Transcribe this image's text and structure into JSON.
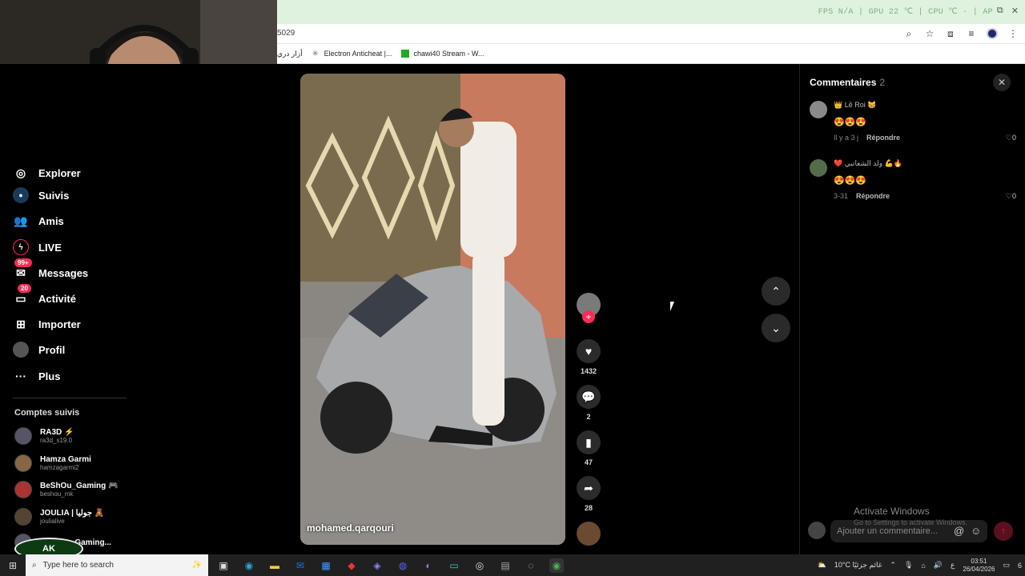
{
  "browser": {
    "hud_text": "FPS N/A  |  GPU 22 ℃  |  CPU ℃  ·  |  AP",
    "url_fragment": "5029",
    "bookmarks": [
      {
        "label": "أزار دري",
        "icon": "folder-icon"
      },
      {
        "label": "Electron Anticheat |...",
        "icon": "electron-icon"
      },
      {
        "label": "chawi40 Stream - W...",
        "icon": "kick-icon"
      }
    ]
  },
  "sidebar": {
    "nav": [
      {
        "label": "Explorer",
        "icon": "compass-icon"
      },
      {
        "label": "Suivis",
        "icon": "following-icon"
      },
      {
        "label": "Amis",
        "icon": "friends-icon"
      },
      {
        "label": "LIVE",
        "icon": "live-icon"
      },
      {
        "label": "Messages",
        "icon": "message-icon",
        "badge": "99+"
      },
      {
        "label": "Activité",
        "icon": "activity-icon",
        "badge": "20"
      },
      {
        "label": "Importer",
        "icon": "upload-icon"
      },
      {
        "label": "Profil",
        "icon": "profile-icon"
      },
      {
        "label": "Plus",
        "icon": "more-icon"
      }
    ],
    "following_title": "Comptes suivis",
    "following": [
      {
        "name": "RA3D ⚡",
        "handle": "ra3d_s19.0"
      },
      {
        "name": "Hamza Garmi",
        "handle": "hamzagarmi2"
      },
      {
        "name": "BeShOu_Gaming 🎮",
        "handle": "beshou_mk"
      },
      {
        "name": "JOULIA | جوليا 🧸",
        "handle": "joulialive"
      },
      {
        "name": "Fahouza Gaming...",
        "handle": ""
      }
    ],
    "logo_text": "AK"
  },
  "video": {
    "creator": "mohamed.qarqouri"
  },
  "actions": {
    "likes": "1432",
    "comments": "2",
    "saves": "47",
    "shares": "28"
  },
  "comments_panel": {
    "title": "Commentaires",
    "count": "2",
    "items": [
      {
        "user": "👑 Lē Roi 😸",
        "text": "😍😍😍",
        "time": "Il y a 3 j",
        "reply": "Répondre",
        "likes": "0"
      },
      {
        "user": "❤️ ولد الشعاتبي 💪🔥",
        "text": "😍😍😍",
        "time": "3-31",
        "reply": "Répondre",
        "likes": "0"
      }
    ],
    "input_placeholder": "Ajouter un commentaire..."
  },
  "watermark": {
    "line1": "Activate Windows",
    "line2": "Go to Settings to activate Windows."
  },
  "taskbar": {
    "search_placeholder": "Type here to search",
    "weather": "10°C  غائم جزئيًا",
    "time": "03:51",
    "date": "26/04/2026",
    "lang": "ع",
    "notif": "6"
  },
  "colors": {
    "accent": "#fe2c55",
    "background": "#000000",
    "panel": "#1e1e1e"
  }
}
